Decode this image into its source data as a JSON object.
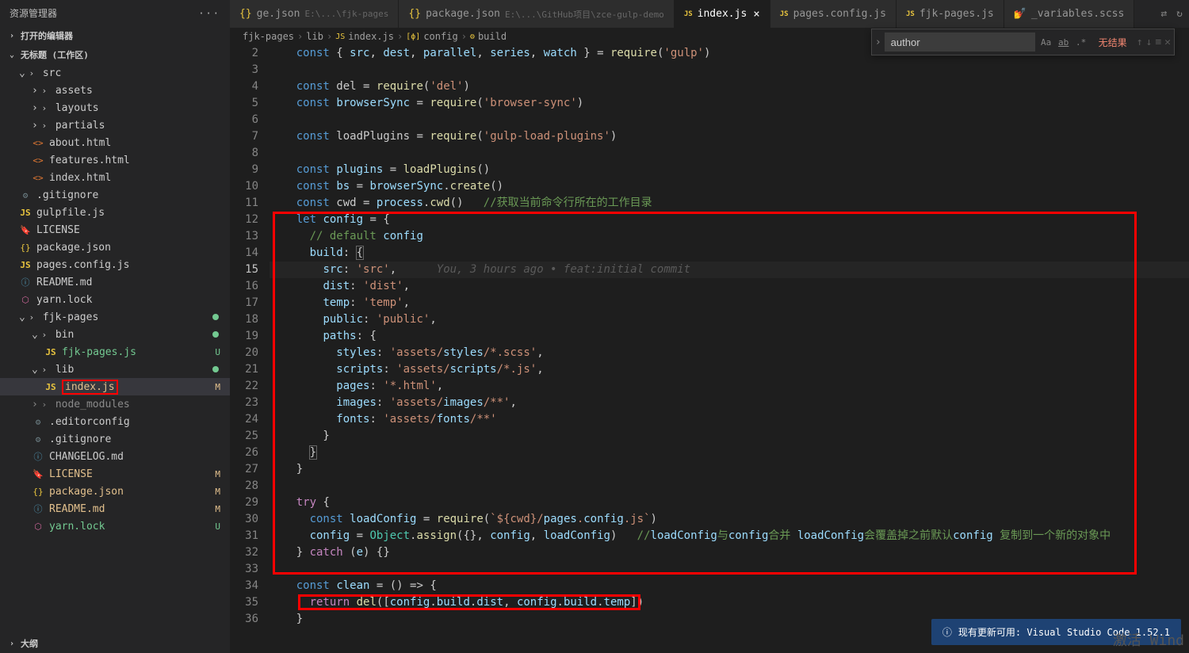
{
  "sidebar": {
    "title": "资源管理器",
    "sections": {
      "openEditors": "打开的编辑器",
      "workspace": "无标题 (工作区)",
      "outline": "大纲"
    },
    "tree": [
      {
        "label": "src",
        "type": "folder",
        "indent": 1,
        "open": true
      },
      {
        "label": "assets",
        "type": "folder",
        "indent": 2
      },
      {
        "label": "layouts",
        "type": "folder",
        "indent": 2
      },
      {
        "label": "partials",
        "type": "folder",
        "indent": 2
      },
      {
        "label": "about.html",
        "type": "html",
        "indent": 2
      },
      {
        "label": "features.html",
        "type": "html",
        "indent": 2
      },
      {
        "label": "index.html",
        "type": "html",
        "indent": 2
      },
      {
        "label": ".gitignore",
        "type": "gear",
        "indent": 1
      },
      {
        "label": "gulpfile.js",
        "type": "js",
        "indent": 1
      },
      {
        "label": "LICENSE",
        "type": "license",
        "indent": 1
      },
      {
        "label": "package.json",
        "type": "json",
        "indent": 1
      },
      {
        "label": "pages.config.js",
        "type": "js",
        "indent": 1
      },
      {
        "label": "README.md",
        "type": "md",
        "indent": 1
      },
      {
        "label": "yarn.lock",
        "type": "lock",
        "indent": 1
      },
      {
        "label": "fjk-pages",
        "type": "folder",
        "indent": 1,
        "open": true,
        "dot": true
      },
      {
        "label": "bin",
        "type": "folder",
        "indent": 2,
        "open": true,
        "dot": true
      },
      {
        "label": "fjk-pages.js",
        "type": "js",
        "indent": 3,
        "status": "U"
      },
      {
        "label": "lib",
        "type": "folder",
        "indent": 2,
        "open": true,
        "dot": true
      },
      {
        "label": "index.js",
        "type": "js",
        "indent": 3,
        "status": "M",
        "boxed": true,
        "selected": true
      },
      {
        "label": "node_modules",
        "type": "folder",
        "indent": 2,
        "dim": true
      },
      {
        "label": ".editorconfig",
        "type": "gear",
        "indent": 2
      },
      {
        "label": ".gitignore",
        "type": "gear",
        "indent": 2
      },
      {
        "label": "CHANGELOG.md",
        "type": "md",
        "indent": 2
      },
      {
        "label": "LICENSE",
        "type": "license",
        "indent": 2,
        "status": "M"
      },
      {
        "label": "package.json",
        "type": "json",
        "indent": 2,
        "status": "M"
      },
      {
        "label": "README.md",
        "type": "md",
        "indent": 2,
        "status": "M"
      },
      {
        "label": "yarn.lock",
        "type": "lock",
        "indent": 2,
        "status": "U"
      }
    ]
  },
  "tabs": [
    {
      "label": "ge.json",
      "path": "E:\\...\\fjk-pages",
      "icon": "json"
    },
    {
      "label": "package.json",
      "path": "E:\\...\\GitHub项目\\zce-gulp-demo",
      "icon": "json"
    },
    {
      "label": "index.js",
      "icon": "js",
      "active": true,
      "close": true
    },
    {
      "label": "pages.config.js",
      "icon": "js"
    },
    {
      "label": "fjk-pages.js",
      "icon": "js"
    },
    {
      "label": "_variables.scss",
      "icon": "scss"
    }
  ],
  "breadcrumb": [
    "fjk-pages",
    "lib",
    "index.js",
    "config",
    "build"
  ],
  "breadcrumb_icons": [
    "",
    "",
    "JS",
    "[ϕ]",
    "⚙"
  ],
  "search": {
    "value": "author",
    "result": "无结果"
  },
  "notification": "现有更新可用: Visual Studio Code 1.52.1",
  "watermark": "激活 Wind",
  "ghost_annotation": "You, 3 hours ago • feat:initial commit",
  "code": {
    "start": 2,
    "lines": [
      "const { src, dest, parallel, series, watch } = require('gulp')",
      "",
      "const del = require('del')",
      "const browserSync = require('browser-sync')",
      "",
      "const loadPlugins = require('gulp-load-plugins')",
      "",
      "const plugins = loadPlugins()",
      "const bs = browserSync.create()",
      "const cwd = process.cwd()   //获取当前命令行所在的工作目录",
      "let config = {",
      "  // default config",
      "  build: {",
      "    src: 'src',",
      "    dist: 'dist',",
      "    temp: 'temp',",
      "    public: 'public',",
      "    paths: {",
      "      styles: 'assets/styles/*.scss',",
      "      scripts: 'assets/scripts/*.js',",
      "      pages: '*.html',",
      "      images: 'assets/images/**',",
      "      fonts: 'assets/fonts/**'",
      "    }",
      "  }",
      "}",
      "",
      "try {",
      "  const loadConfig = require(`${cwd}/pages.config.js`)",
      "  config = Object.assign({}, config, loadConfig)   //loadConfig与config合并 loadConfig会覆盖掉之前默认config 复制到一个新的对象中",
      "} catch (e) {}",
      "",
      "const clean = () => {",
      "  return del([config.build.dist, config.build.temp])",
      "}"
    ]
  }
}
